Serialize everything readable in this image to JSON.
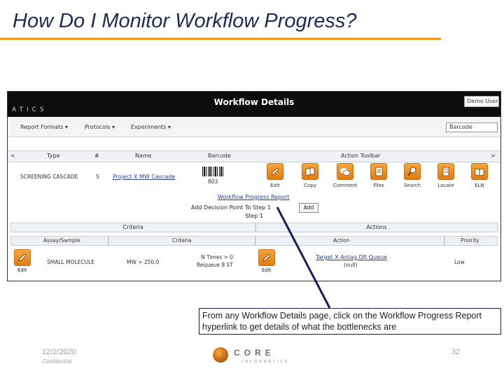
{
  "slide": {
    "title": "How Do I Monitor Workflow Progress?",
    "date": "12/2/2020",
    "confidential": "Confidential",
    "page_number": "32",
    "callout": "From any Workflow Details page, click on the Workflow Progress Report hyperlink to get details of what the bottlenecks are",
    "brand": "CORE",
    "brand_sub": "INFORMATICS",
    "accent_color": "#f39a1e",
    "title_color": "#1f2a56"
  },
  "app": {
    "logo": "ATICS",
    "title": "Workflow Details",
    "user": "Demo User",
    "menus": [
      "Report Formats ▾",
      "Protocols ▾",
      "Experiments ▾"
    ],
    "search_value": "Barcode",
    "columns": {
      "prev": "<",
      "type": "Type",
      "num": "#",
      "name": "Name",
      "barcode": "Barcode",
      "toolbar": "Action Toolbar",
      "next": ">"
    },
    "row": {
      "type": "SCREENING CASCADE",
      "num": "5",
      "name": "Project X MW Cascade",
      "barcode": "803"
    },
    "tools": [
      {
        "label": "Edit",
        "icon": "pencil-icon"
      },
      {
        "label": "Copy",
        "icon": "copy-icon"
      },
      {
        "label": "Comment",
        "icon": "comment-icon"
      },
      {
        "label": "Files",
        "icon": "files-icon"
      },
      {
        "label": "Search",
        "icon": "search-icon"
      },
      {
        "label": "Locate",
        "icon": "locate-icon"
      },
      {
        "label": "ELN",
        "icon": "book-icon"
      }
    ],
    "progress_link": "Workflow Progress Report",
    "decision_label": "Add Decision Point To Step 1",
    "add_button": "Add",
    "step_label": "Step 1",
    "criteria": {
      "header": "Criteria",
      "assay_col": "Assay/Sample",
      "criteria_col": "Criteria",
      "edit_label": "Edit",
      "assay": "SMALL MOLECULE",
      "criterion": "MW > 250.0",
      "n_times": "N Times > 0",
      "requeue": "Requeue 8 ST"
    },
    "actions": {
      "header": "Actions",
      "action_col": "Action",
      "priority_col": "Priority",
      "edit_label": "Edit",
      "action_link": "Target X Antag DR Queue",
      "action_sub": "(null)",
      "priority": "Low"
    }
  }
}
